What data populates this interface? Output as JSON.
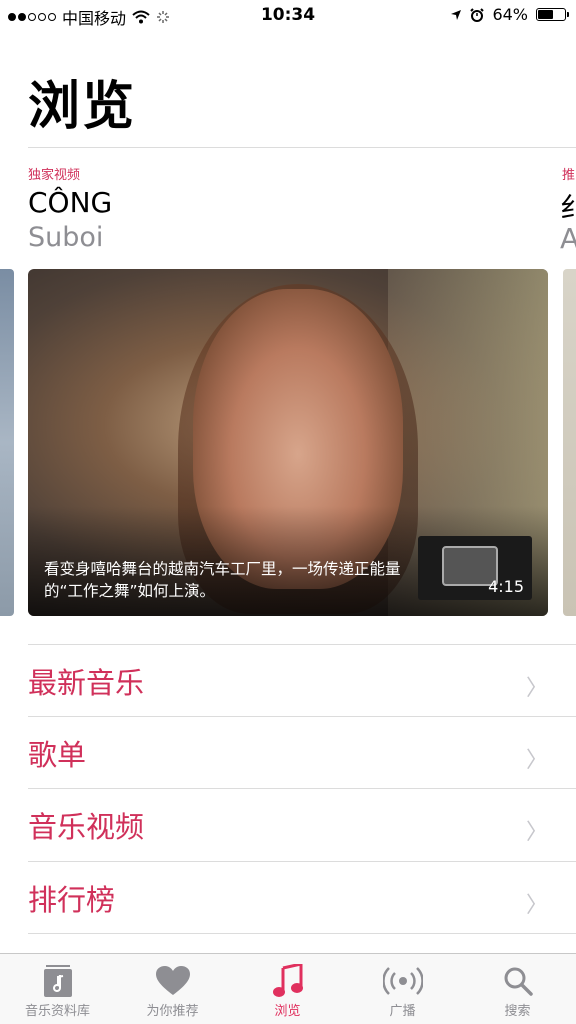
{
  "status_bar": {
    "carrier": "中国移动",
    "time": "10:34",
    "battery": "64%",
    "battery_level": 0.64
  },
  "page": {
    "title": "浏览"
  },
  "featured": {
    "eyebrow": "独家视频",
    "title": "CÔNG",
    "subtitle": "Suboi",
    "caption": "看变身嘻哈舞台的越南汽车工厂里，一场传递正能量的“工作之舞”如何上演。",
    "duration": "4:15",
    "peek_right_eyebrow": "推",
    "peek_right_title": "纟",
    "peek_right_subtitle": "A"
  },
  "list": [
    {
      "label": "最新音乐"
    },
    {
      "label": "歌单"
    },
    {
      "label": "音乐视频"
    },
    {
      "label": "排行榜"
    }
  ],
  "tabbar": {
    "tabs": [
      {
        "label": "音乐资料库",
        "icon": "library-icon"
      },
      {
        "label": "为你推荐",
        "icon": "heart-icon"
      },
      {
        "label": "浏览",
        "icon": "music-note-icon"
      },
      {
        "label": "广播",
        "icon": "radio-icon"
      },
      {
        "label": "搜索",
        "icon": "search-icon"
      }
    ],
    "active_index": 2
  },
  "colors": {
    "accent": "#d0305a",
    "secondary_text": "#8e8e93"
  }
}
